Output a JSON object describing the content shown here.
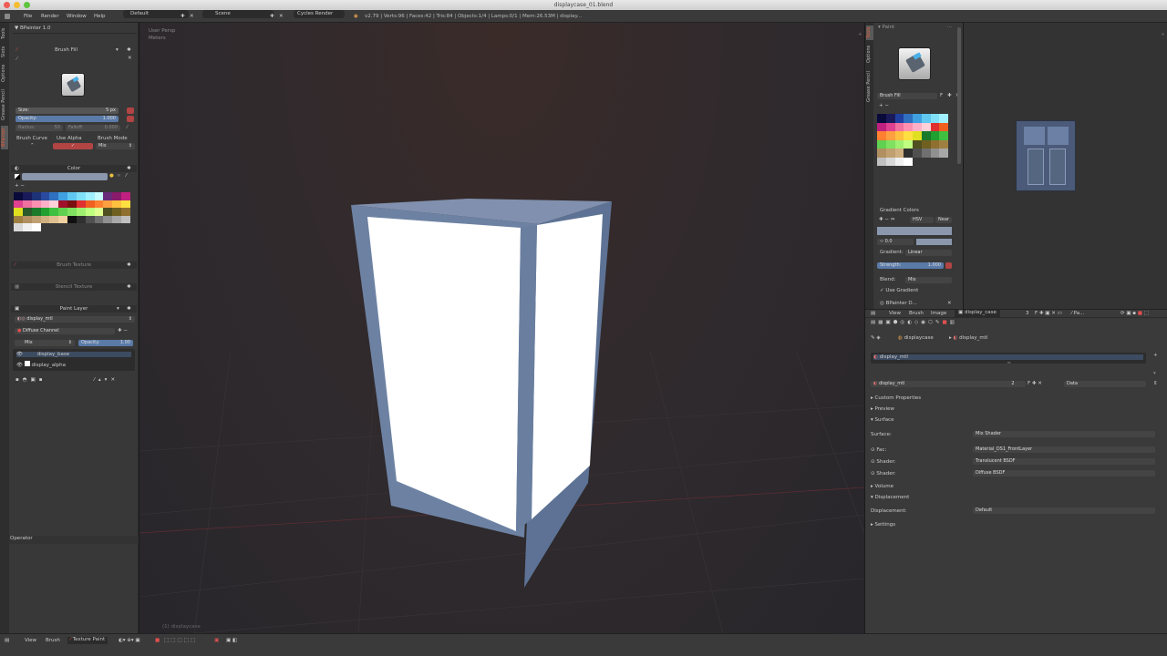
{
  "window": {
    "title": "displaycase_01.blend"
  },
  "infobar": {
    "menus": [
      "File",
      "Render",
      "Window",
      "Help"
    ],
    "layout": "Default",
    "scene": "Scene",
    "engine": "Cycles Render",
    "stats": "v2.79 | Verts:96 | Faces:42 | Tris:84 | Objects:1/4 | Lamps:0/1 | Mem:26.53M | display..."
  },
  "left_tabs": [
    "Tools",
    "Slots",
    "Options",
    "Grease Pencil",
    "BPainter"
  ],
  "left_panel": {
    "addon_title": "BPainter 1.0",
    "brush_name": "Brush Fill",
    "size_label": "Size:",
    "size_value": "5 px",
    "opacity_label": "Opacity:",
    "opacity_value": "1.000",
    "radius_label": "Radius:",
    "radius_value": "50",
    "falloff_label": "Falloff:",
    "falloff_value": "0.000",
    "brush_curve": "Brush Curve",
    "use_alpha": "Use Alpha",
    "brush_mode": "Brush Mode",
    "brush_mode_value": "Mix",
    "color_header": "Color",
    "brush_texture": "Brush Texture",
    "stencil_texture": "Stencil Texture",
    "paint_layer_header": "Paint Layer",
    "material": "display_mtl",
    "channel": "Diffuse Channel",
    "blend_mode": "Mix",
    "layer_opacity_label": "Opacity:",
    "layer_opacity_value": "1.00",
    "layers": [
      "display_base",
      "display_alpha"
    ],
    "operator_header": "Operator"
  },
  "viewport": {
    "view_label": "User Persp",
    "units_label": "Meters",
    "object_label": "(1) displaycase"
  },
  "right_panel": {
    "tabs": [
      "Tools",
      "Options",
      "Grease Pencil"
    ],
    "paint_header": "Paint",
    "brush_name": "Brush Fill",
    "gradient_colors": "Gradient Colors",
    "gradient_space": "HSV",
    "gradient_interp": "Near",
    "gradient_pos": "0.0",
    "gradient_label": "Gradient:",
    "gradient_type": "Linear",
    "strength_label": "Strength:",
    "strength_value": "1.000",
    "blend_label": "Blend:",
    "blend_value": "Mix",
    "use_gradient": "Use Gradient",
    "bpainter_d": "BPainter D..."
  },
  "image_editor_header": {
    "view": "View",
    "brush": "Brush",
    "image": "Image",
    "image_name": "display_case",
    "users": "3",
    "paint": "Pa..."
  },
  "properties": {
    "breadcrumb_object": "displaycase",
    "breadcrumb_material": "display_mtl",
    "slot": "display_mtl",
    "material_name": "display_mtl",
    "material_users": "2",
    "data_label": "Data",
    "sections": [
      "Custom Properties",
      "Preview",
      "Surface"
    ],
    "surface_label": "Surface:",
    "surface_value": "Mix Shader",
    "fac_label": "Fac:",
    "fac_value": "Material_DS1_FrontLayer",
    "shader1_label": "Shader:",
    "shader1_value": "Translucent BSDF",
    "shader2_label": "Shader:",
    "shader2_value": "Diffuse BSDF",
    "volume": "Volume",
    "displacement_section": "Displacement",
    "displacement_label": "Displacement:",
    "displacement_value": "Default",
    "settings": "Settings"
  },
  "bottombar": {
    "view": "View",
    "brush": "Brush",
    "mode": "Texture Paint"
  },
  "colors": {
    "accent": "#5a7aa8",
    "cabinet": "#6f84a6",
    "red_field": "#b24444"
  },
  "palette_left": [
    "#0a0a3a",
    "#1a1a5a",
    "#1e3278",
    "#2a4aa0",
    "#3070c0",
    "#40a0e0",
    "#60c8f0",
    "#80e0f8",
    "#a0f0ff",
    "#c8fcff",
    "#6a2a7a",
    "#8a1a6a",
    "#c02080",
    "#e04090",
    "#f070a0",
    "#ff90b0",
    "#ffb0c8",
    "#ffd0d8",
    "#a0102a",
    "#7a1010",
    "#e03030",
    "#f06020",
    "#ff8030",
    "#ffa040",
    "#ffc040",
    "#ffe040",
    "#e0e020",
    "#2a5a2a",
    "#1a7a2a",
    "#20a030",
    "#40c040",
    "#60d050",
    "#80e060",
    "#a0f070",
    "#c0ff80",
    "#e0ff90",
    "#505020",
    "#706020",
    "#907030",
    "#a08040",
    "#b09060",
    "#c0a070",
    "#d0b080",
    "#e0c090",
    "#f0d0a0",
    "#101010",
    "#303030",
    "#505050",
    "#707070",
    "#909090",
    "#a8a8a8",
    "#c0c0c0",
    "#d8d8d8",
    "#f0f0f0",
    "#ffffff"
  ],
  "palette_right": [
    "#0a0a3a",
    "#1a1a5a",
    "#2040a0",
    "#3070c0",
    "#40a0e0",
    "#60c8f0",
    "#80e0f8",
    "#a0f0ff",
    "#c02080",
    "#e04090",
    "#f070a0",
    "#ff90b0",
    "#ffb0c8",
    "#ffd0d8",
    "#e03030",
    "#f06020",
    "#ff8030",
    "#ffa040",
    "#ffc040",
    "#ffe040",
    "#e0e020",
    "#1a7a2a",
    "#20a030",
    "#40c040",
    "#60d050",
    "#80e060",
    "#a0f070",
    "#c0ff80",
    "#505020",
    "#706020",
    "#907030",
    "#a08040",
    "#b09060",
    "#c0a070",
    "#d0b080",
    "#303030",
    "#505050",
    "#707070",
    "#909090",
    "#a8a8a8",
    "#c0c0c0",
    "#d8d8d8",
    "#f0f0f0",
    "#ffffff"
  ]
}
